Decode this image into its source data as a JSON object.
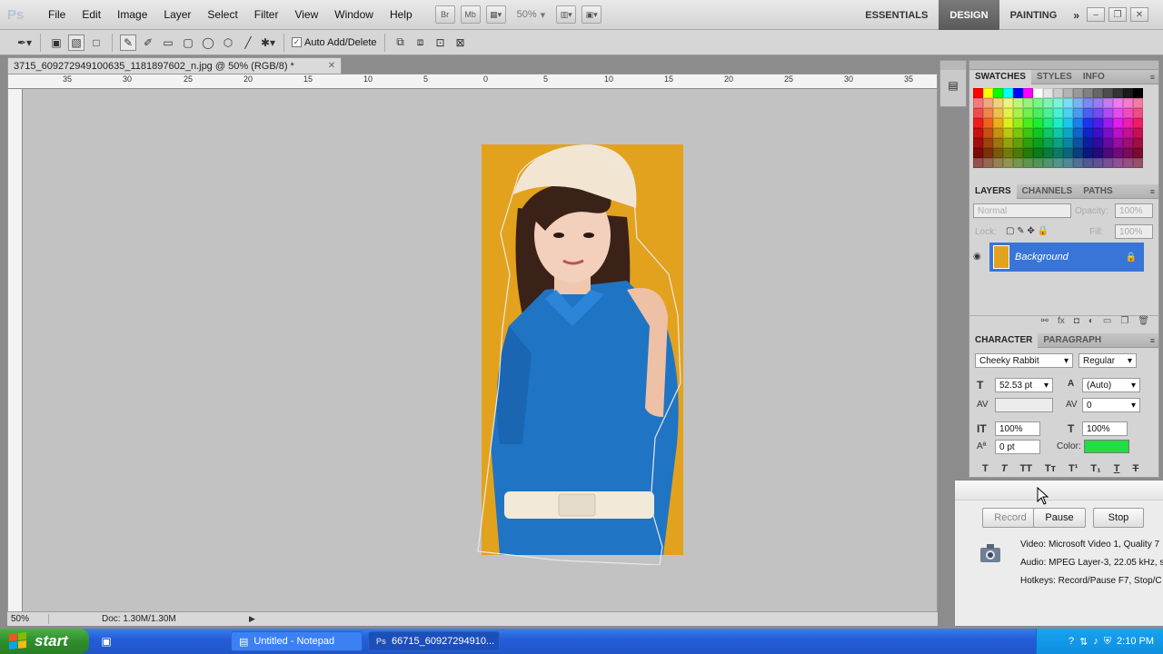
{
  "app": {
    "logo": "Ps",
    "menu": [
      "File",
      "Edit",
      "Image",
      "Layer",
      "Select",
      "Filter",
      "View",
      "Window",
      "Help"
    ],
    "bridge_label": "Br",
    "minibridge_label": "Mb",
    "zoom_level": "50%",
    "workspaces": [
      {
        "label": "ESSENTIALS",
        "active": false
      },
      {
        "label": "DESIGN",
        "active": true
      },
      {
        "label": "PAINTING",
        "active": false
      }
    ],
    "workspaces_more": "»"
  },
  "options": {
    "auto_add_delete_label": "Auto Add/Delete",
    "auto_add_delete_checked": "✓"
  },
  "document": {
    "tab_title": "3715_609272949100635_1181897602_n.jpg @ 50% (RGB/8) *",
    "ruler_ticks": [
      "35",
      "30",
      "25",
      "20",
      "15",
      "10",
      "5",
      "0",
      "5",
      "10",
      "15",
      "20",
      "25",
      "30",
      "35"
    ],
    "status_zoom": "50%",
    "status_doc": "Doc: 1.30M/1.30M"
  },
  "colors": {
    "foreground": "#22dd44",
    "background": "#a0521e",
    "character_color": "#22dd44"
  },
  "panels": {
    "swatches_tabs": [
      "SWATCHES",
      "STYLES",
      "INFO"
    ],
    "layers_tabs": [
      "LAYERS",
      "CHANNELS",
      "PATHS"
    ],
    "blend_mode": "Normal",
    "opacity_label": "Opacity:",
    "opacity_value": "100%",
    "lock_label": "Lock:",
    "fill_label": "Fill:",
    "fill_value": "100%",
    "layer_name": "Background",
    "character_tabs": [
      "CHARACTER",
      "PARAGRAPH"
    ],
    "font_family": "Cheeky Rabbit",
    "font_style": "Regular",
    "font_size": "52.53 pt",
    "leading": "(Auto)",
    "kerning": "",
    "tracking": "0",
    "vertical_scale": "100%",
    "horizontal_scale": "100%",
    "baseline_shift": "0 pt",
    "color_label": "Color:"
  },
  "recorder": {
    "record_label": "Record",
    "pause_label": "Pause",
    "stop_label": "Stop",
    "video_info": "Video: Microsoft Video 1, Quality 7",
    "audio_info": "Audio: MPEG Layer-3, 22.05 kHz, s",
    "hotkeys_info": "Hotkeys: Record/Pause F7, Stop/C"
  },
  "taskbar": {
    "start_label": "start",
    "tasks": [
      "Untitled - Notepad",
      "66715_60927294910..."
    ],
    "clock": "2:10 PM"
  }
}
